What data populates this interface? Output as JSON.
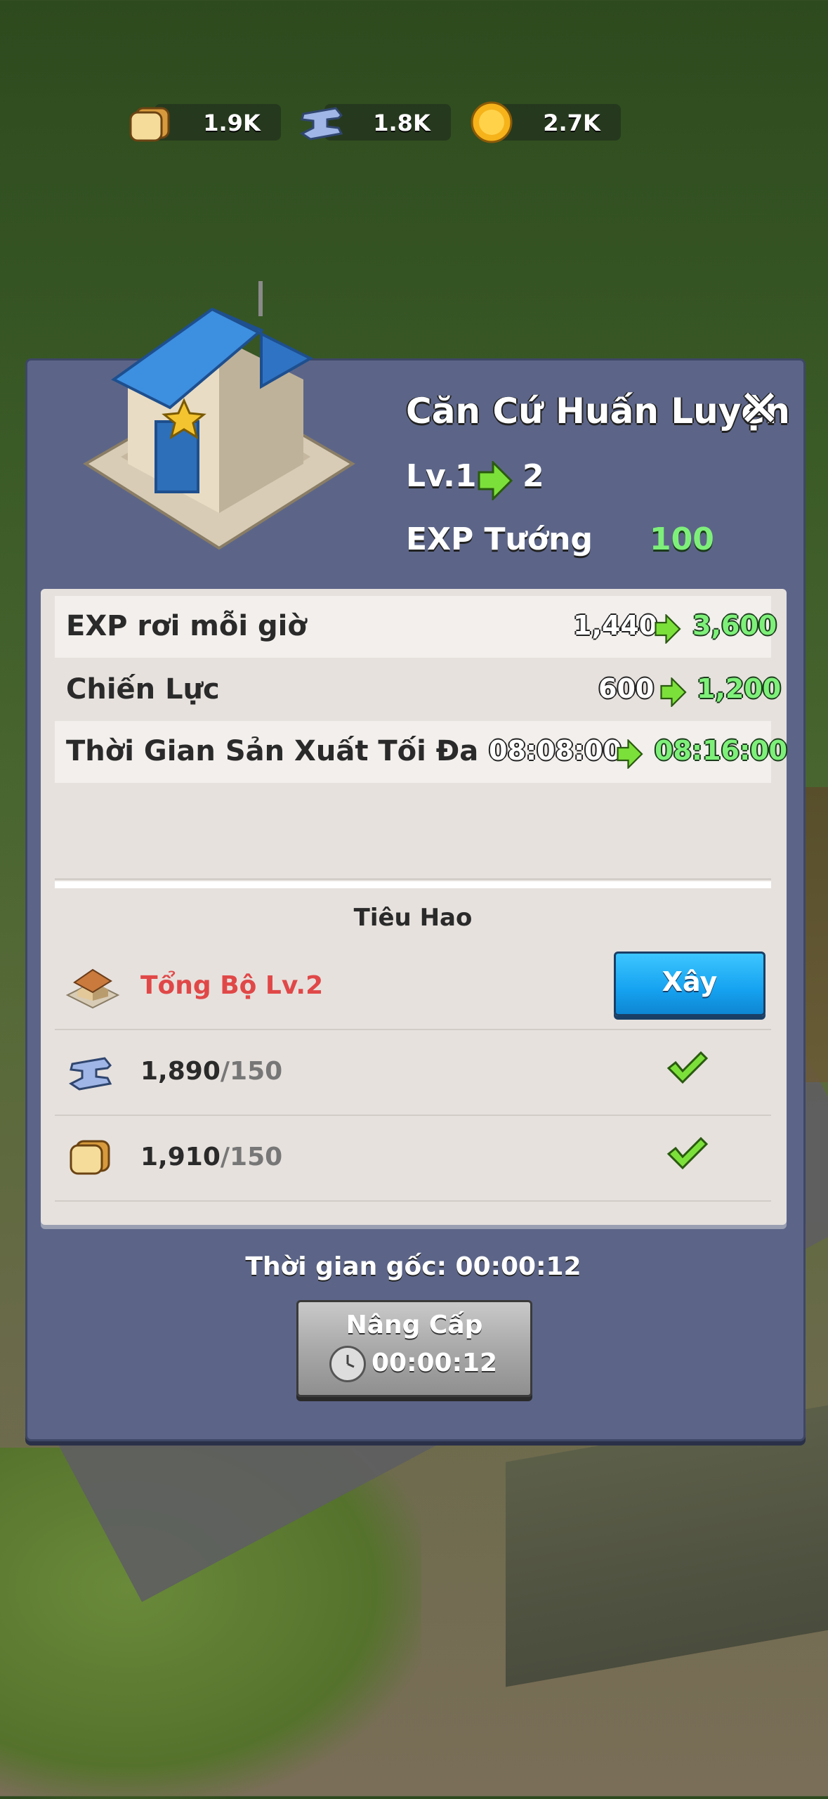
{
  "resources": [
    {
      "icon": "bread-icon",
      "value": "1.9K"
    },
    {
      "icon": "iron-ingot-icon",
      "value": "1.8K"
    },
    {
      "icon": "gold-coin-icon",
      "value": "2.7K"
    }
  ],
  "panel": {
    "title": "Căn Cứ Huấn Luyện",
    "level_from": "Lv.1",
    "level_to": "2",
    "exp_label": "EXP Tướng",
    "exp_value": "100"
  },
  "stats": [
    {
      "label": "EXP rơi mỗi giờ",
      "from": "1,440",
      "to": "3,600"
    },
    {
      "label": "Chiến Lực",
      "from": "600",
      "to": "1,200"
    },
    {
      "label": "Thời Gian Sản Xuất Tối Đa",
      "from": "08:08:00",
      "to": "08:16:00"
    }
  ],
  "cost": {
    "section_title": "Tiêu Hao",
    "requirement": {
      "label": "Tổng Bộ Lv.2",
      "button": "Xây"
    },
    "items": [
      {
        "icon": "iron-ingot-icon",
        "have": "1,890",
        "need": "/150"
      },
      {
        "icon": "bread-icon",
        "have": "1,910",
        "need": "/150"
      }
    ]
  },
  "base_time": "Thời gian gốc: 00:00:12",
  "upgrade": {
    "label": "Nâng Cấp",
    "time": "00:00:12"
  },
  "colors": {
    "panel": "#5c6588",
    "green": "#7ef07a",
    "red": "#e04848",
    "button_blue": "#15a2f0"
  }
}
